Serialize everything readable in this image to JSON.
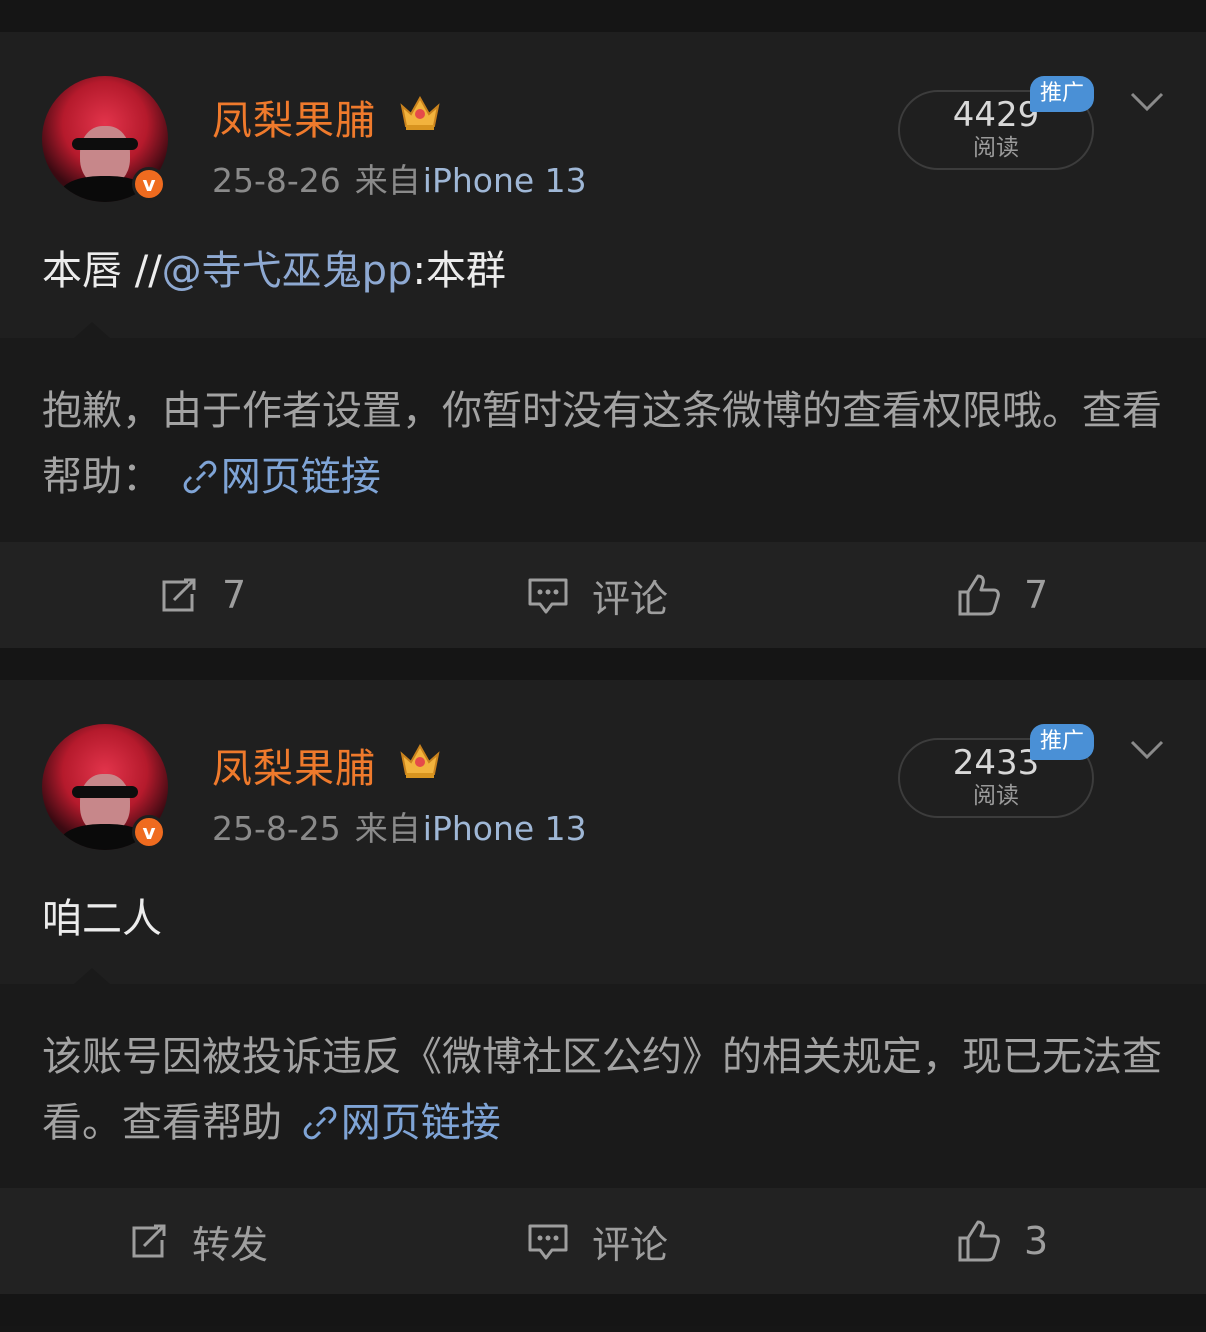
{
  "posts": [
    {
      "username": "凤梨果脯",
      "date": "25-8-26",
      "source_prefix": "来自",
      "device": "iPhone 13",
      "read_count": "4429",
      "read_label": "阅读",
      "promo_badge": "推广",
      "text_before": "本唇 //",
      "mention": "@寺弋巫鬼pp",
      "text_after": ":本群",
      "quote_text": "抱歉，由于作者设置，你暂时没有这条微博的查看权限哦。查看帮助：",
      "quote_link": "网页链接",
      "repost_label": "7",
      "comment_label": "评论",
      "like_label": "7"
    },
    {
      "username": "凤梨果脯",
      "date": "25-8-25",
      "source_prefix": "来自",
      "device": "iPhone 13",
      "read_count": "2433",
      "read_label": "阅读",
      "promo_badge": "推广",
      "text": "咱二人",
      "quote_text": "该账号因被投诉违反《微博社区公约》的相关规定，现已无法查看。查看帮助",
      "quote_link": "网页链接",
      "repost_label": "转发",
      "comment_label": "评论",
      "like_label": "3"
    }
  ],
  "colors": {
    "username": "#ef7a2c",
    "mention": "#8ea9d2",
    "link": "#7fa4d6",
    "promo": "#4a90d6",
    "verified": "#ef6b1f"
  },
  "icons": [
    "crown-icon",
    "verified-badge-icon",
    "chevron-down-icon",
    "link-icon",
    "repost-icon",
    "comment-icon",
    "like-icon"
  ]
}
